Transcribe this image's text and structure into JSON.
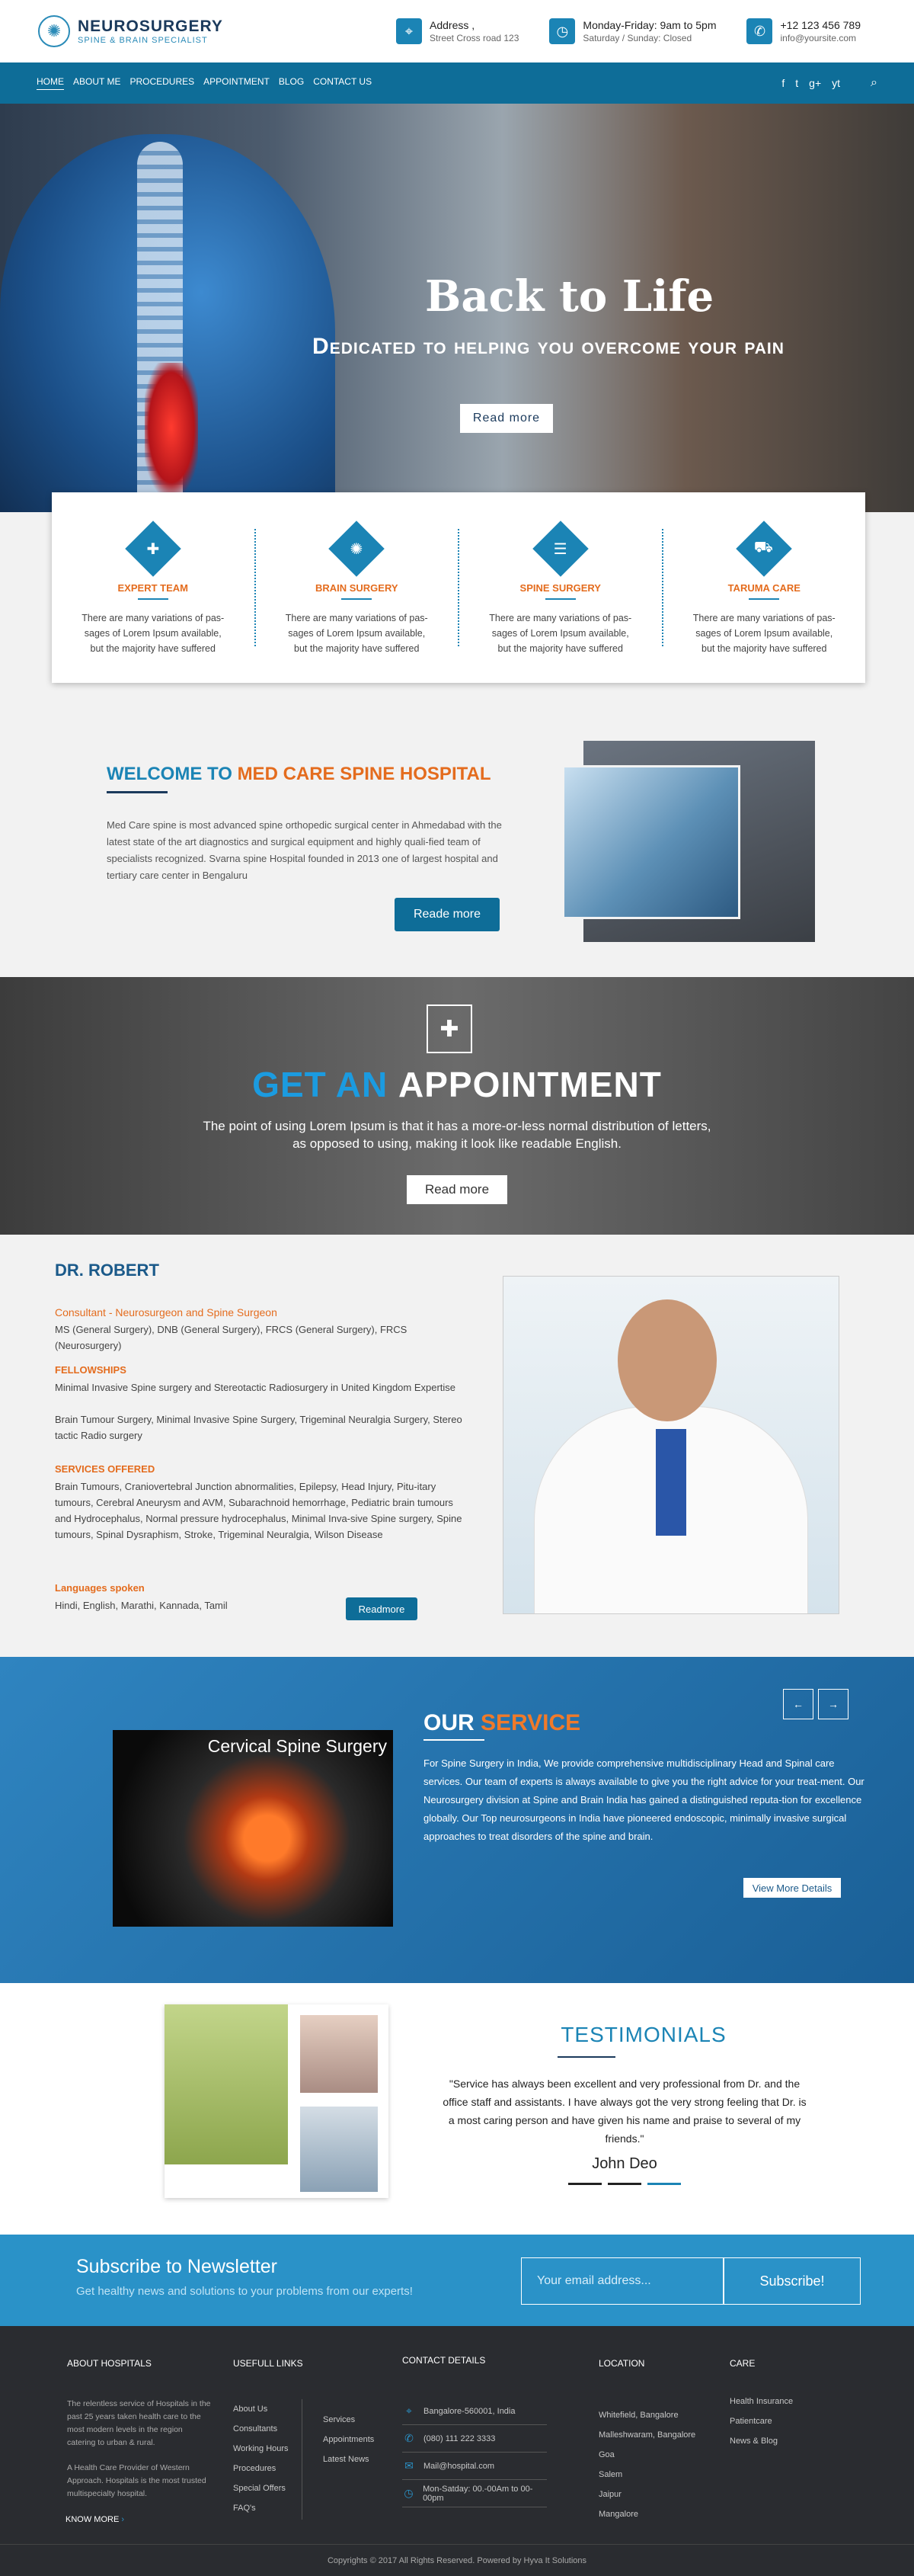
{
  "header": {
    "logo_icon": "brain-icon",
    "logo_title": "NEUROSURGERY",
    "logo_subtitle": "SPINE & BRAIN SPECIALIST",
    "address_label": "Address ,",
    "address_value": "Street Cross road 123",
    "hours_label": "Monday-Friday: 9am to 5pm",
    "hours_value": "Saturday / Sunday: Closed",
    "phone": "+12 123 456 789",
    "email": "info@yoursite.com"
  },
  "nav": {
    "items": [
      "HOME",
      "ABOUT ME",
      "PROCEDURES",
      "APPOINTMENT",
      "BLOG",
      "CONTACT US"
    ],
    "social": [
      "f",
      "t",
      "g+",
      "yt"
    ]
  },
  "hero": {
    "title": "Back to Life",
    "subtitle": "Dedicated to helping you overcome your pain",
    "button": "Read more"
  },
  "features": [
    {
      "icon": "hand-care-icon",
      "title": "EXPERT TEAM",
      "text": "There are many variations of pas-sages of Lorem Ipsum available, but the majority have suffered"
    },
    {
      "icon": "brain-icon",
      "title": "BRAIN SURGERY",
      "text": "There are many variations of pas-sages of Lorem Ipsum available, but the majority have suffered"
    },
    {
      "icon": "spine-icon",
      "title": "SPINE SURGERY",
      "text": "There are many variations of pas-sages of Lorem Ipsum available, but the majority have suffered"
    },
    {
      "icon": "ambulance-icon",
      "title": "TARUMA CARE",
      "text": "There are many variations of pas-sages of Lorem Ipsum available, but the majority have suffered"
    }
  ],
  "welcome": {
    "title_a": "WELCOME TO",
    "title_b": "MED CARE SPINE HOSPITAL",
    "text": "Med Care spine is most advanced spine orthopedic surgical center in Ahmedabad with the latest state of the art diagnostics and surgical equipment and highly quali-fied team of specialists recognized. Svarna spine Hospital founded in 2013 one of largest hospital and tertiary care center in Bengaluru",
    "button": "Reade more"
  },
  "appointment": {
    "title_a": "GET AN",
    "title_b": "APPOINTMENT",
    "text": "The point of using Lorem Ipsum is that it has a more-or-less normal distribution of letters, as opposed to using, making it look like readable English.",
    "button": "Read more"
  },
  "doctor": {
    "name": "DR. ROBERT",
    "role": "Consultant - Neurosurgeon and Spine Surgeon",
    "degrees": "MS (General Surgery), DNB (General Surgery), FRCS (General Surgery), FRCS (Neurosurgery)",
    "fellowships_label": "FELLOWSHIPS",
    "fellowships": "Minimal Invasive Spine surgery and Stereotactic Radiosurgery in United Kingdom Expertise",
    "expertise": "Brain Tumour Surgery, Minimal Invasive Spine Surgery, Trigeminal Neuralgia Surgery, Stereo tactic Radio surgery",
    "services_label": "SERVICES OFFERED",
    "services": "Brain Tumours, Craniovertebral Junction abnormalities, Epilepsy, Head Injury, Pitu-itary tumours, Cerebral Aneurysm and AVM, Subarachnoid hemorrhage, Pediatric brain tumours and Hydrocephalus, Normal pressure hydrocephalus, Minimal Inva-sive Spine surgery, Spine tumours, Spinal Dysraphism, Stroke, Trigeminal Neuralgia, Wilson Disease",
    "languages_label": "Languages spoken",
    "languages": "Hindi, English, Marathi, Kannada, Tamil",
    "button": "Readmore"
  },
  "service": {
    "image_caption": "Cervical Spine Surgery",
    "title_a": "OUR",
    "title_b": "SERVICE",
    "text": "For Spine Surgery in India, We provide comprehensive multidisciplinary Head and Spinal care services. Our team of experts is always available to give you the right advice for your treat-ment. Our Neurosurgery division at Spine and Brain India has gained a distinguished reputa-tion for excellence globally. Our Top neurosurgeons in India have pioneered endoscopic, minimally invasive surgical approaches to treat disorders of the spine and brain.",
    "button": "View More Details"
  },
  "testimonials": {
    "title": "TESTIMONIALS",
    "quote": "\"Service has always been excellent and very professional from Dr. and the office staff and assistants. I have always got the very strong feeling that Dr. is a most caring person and have given his name and praise to several of my friends.\"",
    "name": "John Deo"
  },
  "newsletter": {
    "title": "Subscribe to Newsletter",
    "subtitle": "Get healthy news and solutions to your problems from our experts!",
    "placeholder": "Your email address...",
    "button": "Subscribe!"
  },
  "footer": {
    "about_title": "ABOUT HOSPITALS",
    "about_text1": "The relentless service of Hospitals in the past 25 years taken health care to the most modern levels in the region catering to urban & rural.",
    "about_text2": "A Health Care Provider of Western Approach. Hospitals is the most trusted multispecialty hospital.",
    "know_more": "KNOW MORE",
    "links_title": "USEFULL LINKS",
    "links1": [
      "About Us",
      "Consultants",
      "Working Hours",
      "Procedures",
      "Special Offers",
      "FAQ's"
    ],
    "links2": [
      "Services",
      "Appointments",
      "Latest News"
    ],
    "contact_title": "CONTACT DETAILS",
    "contact": [
      {
        "icon": "map-pin-icon",
        "text": "Bangalore-560001, India"
      },
      {
        "icon": "phone-icon",
        "text": "(080) 111 222 3333"
      },
      {
        "icon": "mail-icon",
        "text": "Mail@hospital.com"
      },
      {
        "icon": "clock-icon",
        "text": "Mon-Satday: 00.-00Am to 00-00pm"
      }
    ],
    "location_title": "LOCATION",
    "locations": [
      "Whitefield, Bangalore",
      "Malleshwaram, Bangalore",
      "Goa",
      "Salem",
      "Jaipur",
      "Mangalore"
    ],
    "care_title": "CARE",
    "care": [
      "Health Insurance",
      "Patientcare",
      "News & Blog"
    ],
    "copyright": "Copyrights © 2017 All Rights Reserved. Powered by  Hyva It Solutions"
  }
}
